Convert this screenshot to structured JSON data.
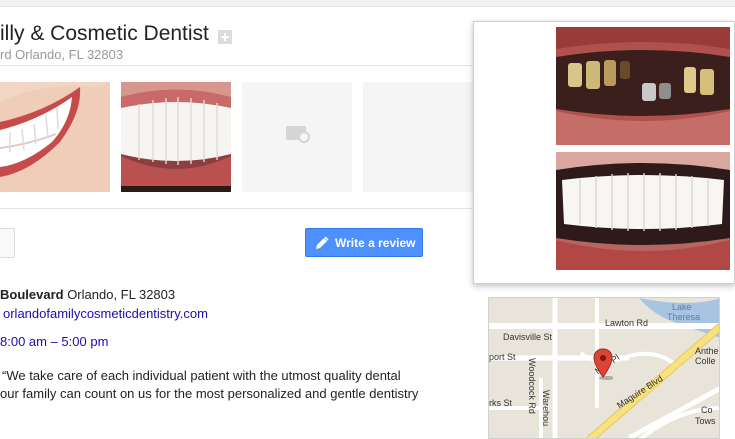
{
  "business": {
    "title": "illy & Cosmetic Dentist",
    "address_line": "rd Orlando, FL 32803"
  },
  "actions": {
    "write_review": "Write a review"
  },
  "info": {
    "address_street": "Boulevard",
    "address_city": " Orlando, FL 32803",
    "website": "orlandofamilycosmeticdentistry.com",
    "hours": "8:00 am – 5:00 pm",
    "description_line1": "“We take care of each individual patient with the utmost quality dental",
    "description_line2": "our family can count on us for the most personalized and gentle dentistry"
  },
  "map": {
    "labels": {
      "davisville": "Davisville St",
      "lawton": "Lawton Rd",
      "lake": "Lake",
      "theresa": "Theresa",
      "woodcock": "Woodcock Rd",
      "myrtle": "M  le Pl",
      "maguire": "Maguire Blvd",
      "port": "port St",
      "rks": "rks St",
      "warehouse": "Warehou",
      "anthe": "Anthe",
      "colle": "Colle",
      "tows": "Tows",
      "co": "Co"
    }
  },
  "colors": {
    "accent_blue": "#4d90fe",
    "link_blue": "#1a0dab",
    "road_yellow": "#f7e27f",
    "pin_red": "#db4437"
  }
}
